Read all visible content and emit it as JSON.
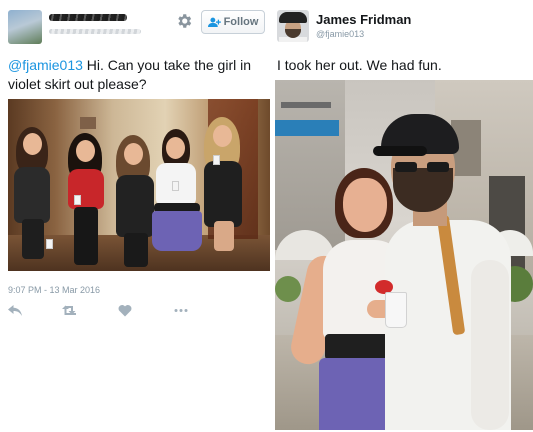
{
  "left_tweet": {
    "follow_label": "Follow",
    "text_mention": "@fjamie013",
    "text_body": " Hi. Can you take the girl in violet skirt out please?",
    "timestamp": "9:07 PM - 13 Mar 2016",
    "photo_subject": "group of girls at a party"
  },
  "right_tweet": {
    "name": "James Fridman",
    "handle": "@fjamie013",
    "text": "I took her out. We had fun.",
    "photo_subject": "man with cap and beard posing with girl in violet skirt on a street"
  },
  "icons": {
    "settings": "gear-icon",
    "follow": "add-user-icon",
    "reply": "reply-icon",
    "retweet": "retweet-icon",
    "like": "heart-icon",
    "more": "more-icon"
  },
  "colors": {
    "mention": "#1b95e0",
    "muted": "#8899a6",
    "action_icons": "#a3b1bc",
    "skirt": "#6d63b4"
  }
}
